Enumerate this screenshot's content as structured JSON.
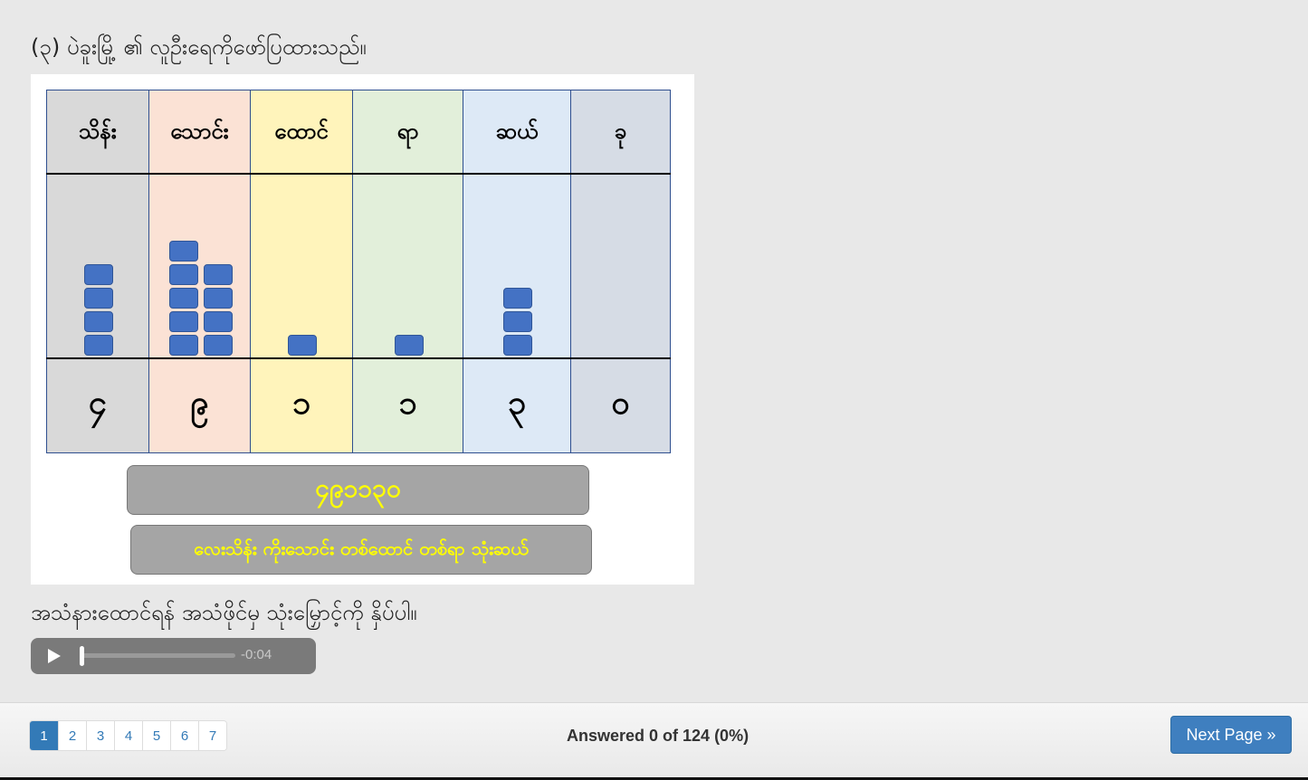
{
  "question": {
    "text": "(၃) ပဲခူးမြို့ ၏ လူဦးရေကိုဖော်ပြထားသည်။"
  },
  "figure": {
    "columns": [
      {
        "header": "သိန်း",
        "digit": "၄",
        "count": 4,
        "bg": "#d9d9d9"
      },
      {
        "header": "သောင်း",
        "digit": "၉",
        "count": 9,
        "bg": "#fbe2d5"
      },
      {
        "header": "ထောင်",
        "digit": "၁",
        "count": 1,
        "bg": "#fff4bb"
      },
      {
        "header": "ရာ",
        "digit": "၁",
        "count": 1,
        "bg": "#e2efda"
      },
      {
        "header": "ဆယ်",
        "digit": "၃",
        "count": 3,
        "bg": "#dde9f6"
      },
      {
        "header": "ခု",
        "digit": "၀",
        "count": 0,
        "bg": "#d6dce5"
      }
    ],
    "number": "၄၉၁၁၃၀",
    "words": "လေးသိန်း ကိုးသောင်း တစ်ထောင် တစ်ရာ သုံးဆယ်"
  },
  "instruction": {
    "text": "အသံနားထောင်ရန် အသံဖိုင်မှ သုံးမြှောင့်ကို နှိပ်ပါ။"
  },
  "audio": {
    "time": "-0:04",
    "play_icon": "play-icon",
    "progress": 0
  },
  "footer": {
    "pages": [
      "1",
      "2",
      "3",
      "4",
      "5",
      "6",
      "7"
    ],
    "active_page": "1",
    "progress_text": "Answered 0 of 124 (0%)",
    "next_label": "Next Page »"
  }
}
